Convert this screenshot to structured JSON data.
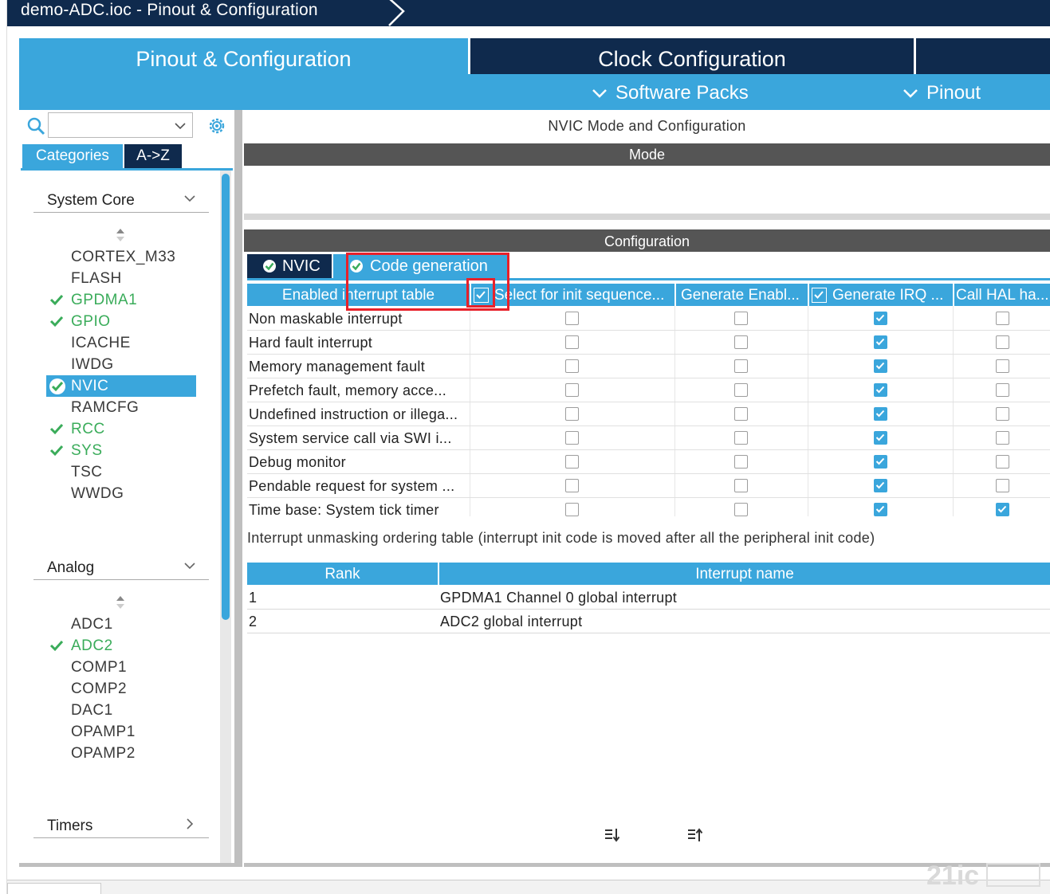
{
  "window": {
    "title": "demo-ADC.ioc - Pinout & Configuration"
  },
  "main_tabs": {
    "pinout": "Pinout & Configuration",
    "clock": "Clock Configuration"
  },
  "subnav": {
    "software_packs": "Software Packs",
    "pinout": "Pinout"
  },
  "left": {
    "search_value": "",
    "tabs": {
      "categories": "Categories",
      "az": "A->Z"
    },
    "groups": [
      {
        "label": "System Core",
        "items": [
          {
            "label": "CORTEX_M33",
            "checked": false
          },
          {
            "label": "FLASH",
            "checked": false
          },
          {
            "label": "GPDMA1",
            "checked": true
          },
          {
            "label": "GPIO",
            "checked": true
          },
          {
            "label": "ICACHE",
            "checked": false
          },
          {
            "label": "IWDG",
            "checked": false
          },
          {
            "label": "NVIC",
            "checked": true,
            "selected": true
          },
          {
            "label": "RAMCFG",
            "checked": false
          },
          {
            "label": "RCC",
            "checked": true
          },
          {
            "label": "SYS",
            "checked": true
          },
          {
            "label": "TSC",
            "checked": false
          },
          {
            "label": "WWDG",
            "checked": false
          }
        ]
      },
      {
        "label": "Analog",
        "items": [
          {
            "label": "ADC1",
            "checked": false
          },
          {
            "label": "ADC2",
            "checked": true
          },
          {
            "label": "COMP1",
            "checked": false
          },
          {
            "label": "COMP2",
            "checked": false
          },
          {
            "label": "DAC1",
            "checked": false
          },
          {
            "label": "OPAMP1",
            "checked": false
          },
          {
            "label": "OPAMP2",
            "checked": false
          }
        ]
      },
      {
        "label": "Timers",
        "items": []
      }
    ]
  },
  "right": {
    "title": "NVIC Mode and Configuration",
    "mode_label": "Mode",
    "config_label": "Configuration",
    "tabs": {
      "nvic": "NVIC",
      "codegen": "Code generation"
    },
    "interrupt_table": {
      "columns": [
        "Enabled interrupt table",
        "Select for init sequence...",
        "Generate Enabl...",
        "Generate IRQ ...",
        "Call HAL ha..."
      ],
      "header_checks": {
        "select_init": true,
        "generate_irq": true
      },
      "rows": [
        {
          "name": "Non maskable interrupt",
          "init": false,
          "enable": false,
          "irq": true,
          "hal": false
        },
        {
          "name": "Hard fault interrupt",
          "init": false,
          "enable": false,
          "irq": true,
          "hal": false
        },
        {
          "name": "Memory management fault",
          "init": false,
          "enable": false,
          "irq": true,
          "hal": false
        },
        {
          "name": "Prefetch fault, memory acce...",
          "init": false,
          "enable": false,
          "irq": true,
          "hal": false
        },
        {
          "name": "Undefined instruction or illega...",
          "init": false,
          "enable": false,
          "irq": true,
          "hal": false
        },
        {
          "name": "System service call via SWI i...",
          "init": false,
          "enable": false,
          "irq": true,
          "hal": false
        },
        {
          "name": "Debug monitor",
          "init": false,
          "enable": false,
          "irq": true,
          "hal": false
        },
        {
          "name": "Pendable request for system ...",
          "init": false,
          "enable": false,
          "irq": true,
          "hal": false
        },
        {
          "name": "Time base: System tick timer",
          "init": false,
          "enable": false,
          "irq": true,
          "hal": true
        }
      ]
    },
    "note": "Interrupt unmasking ordering table (interrupt init code is moved after all the peripheral init code)",
    "rank_table": {
      "columns": [
        "Rank",
        "Interrupt name"
      ],
      "rows": [
        {
          "rank": "1",
          "name": "GPDMA1 Channel 0 global interrupt"
        },
        {
          "rank": "2",
          "name": "ADC2 global interrupt"
        }
      ]
    }
  },
  "colors": {
    "accent": "#3aa6dc",
    "navy": "#0f2a4d",
    "ok_green": "#3aac5a",
    "highlight_red": "#e8212a"
  }
}
